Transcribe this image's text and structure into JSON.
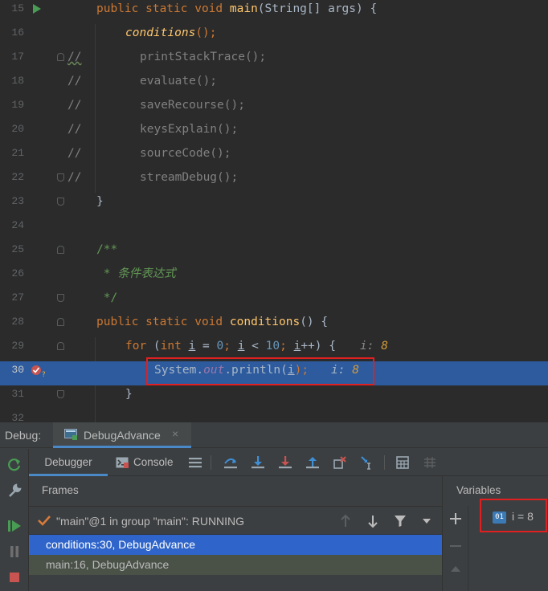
{
  "editor": {
    "lines": [
      {
        "num": "15"
      },
      {
        "num": "16"
      },
      {
        "num": "17"
      },
      {
        "num": "18"
      },
      {
        "num": "19"
      },
      {
        "num": "20"
      },
      {
        "num": "21"
      },
      {
        "num": "22"
      },
      {
        "num": "23"
      },
      {
        "num": "24"
      },
      {
        "num": "25"
      },
      {
        "num": "26"
      },
      {
        "num": "27"
      },
      {
        "num": "28"
      },
      {
        "num": "29"
      },
      {
        "num": "30"
      },
      {
        "num": "31"
      },
      {
        "num": "32"
      }
    ],
    "code": {
      "l15_kw": "public static void ",
      "l15_fn": "main",
      "l15_rest": "(String[] args) {",
      "l16": "conditions",
      "l16_rest": "();",
      "l17": "printStackTrace();",
      "l18": "evaluate();",
      "l19": "saveRecourse();",
      "l20": "keysExplain();",
      "l21": "sourceCode();",
      "l22": "streamDebug();",
      "comment_mark": "//",
      "l23": "}",
      "l25": "/**",
      "l26": " * 条件表达式",
      "l27": " */",
      "l28_kw": "public static void ",
      "l28_fn": "conditions",
      "l28_rest": "() {",
      "l29_for": "for ",
      "l29_open": "(",
      "l29_int": "int ",
      "l29_i1": "i",
      "l29_eq": " = ",
      "l29_zero": "0",
      "l29_semi1": "; ",
      "l29_i2": "i",
      "l29_lt": " < ",
      "l29_ten": "10",
      "l29_semi2": "; ",
      "l29_i3": "i",
      "l29_inc": "++) {",
      "l29_hint": "i: ",
      "l29_hint_val": "8",
      "l30_sys": "System.",
      "l30_out": "out",
      "l30_print": ".println(",
      "l30_i": "i",
      "l30_close": ");",
      "l30_hint": "i: ",
      "l30_hint_val": "8",
      "l31": "}"
    }
  },
  "debug": {
    "title": "Debug:",
    "session_tab": "DebugAdvance",
    "session_close": "×",
    "tabs": {
      "debugger": "Debugger",
      "console": "Console"
    },
    "frames_title": "Frames",
    "variables_title": "Variables",
    "thread": "\"main\"@1 in group \"main\": RUNNING",
    "frames": [
      "conditions:30, DebugAdvance",
      "main:16, DebugAdvance"
    ],
    "variable": {
      "icon_text": "01",
      "text": "i = 8"
    }
  }
}
